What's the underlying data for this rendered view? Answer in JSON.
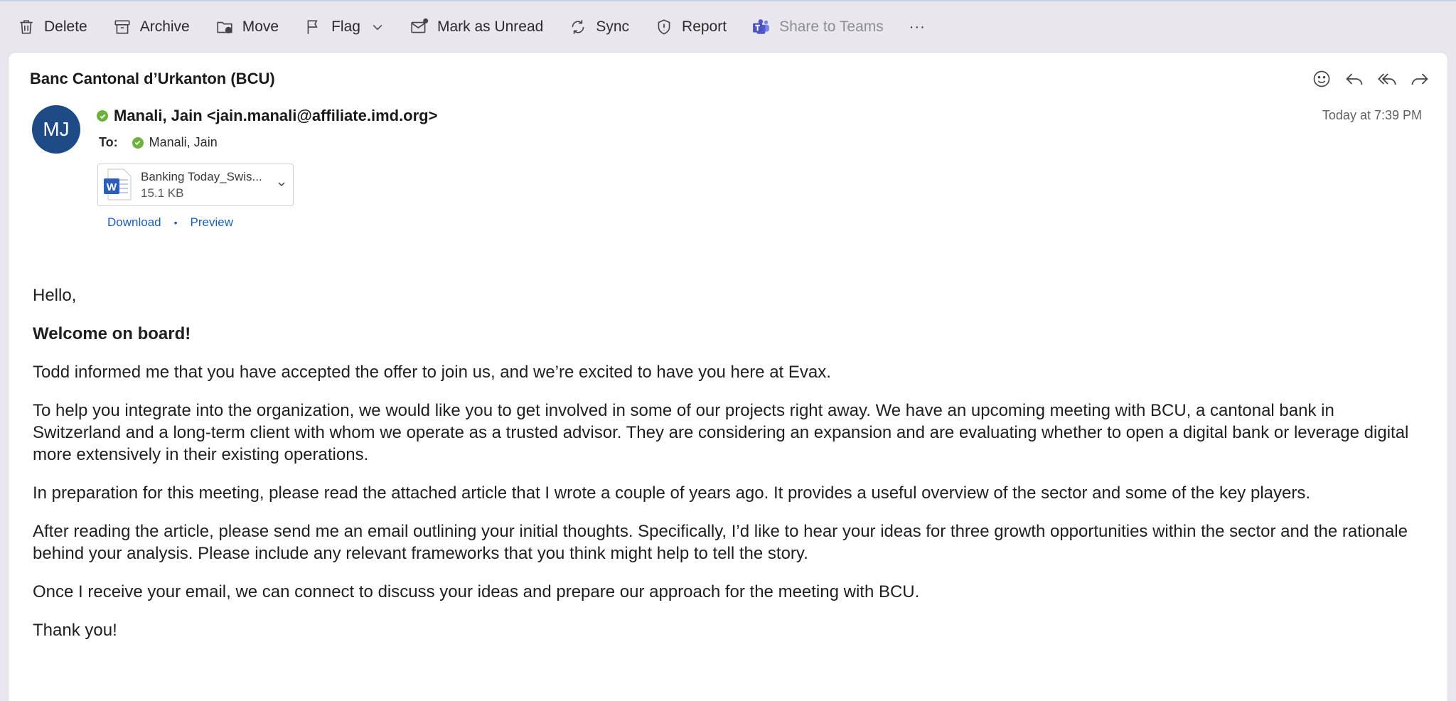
{
  "toolbar": {
    "delete": "Delete",
    "archive": "Archive",
    "move": "Move",
    "flag": "Flag",
    "mark_unread": "Mark as Unread",
    "sync": "Sync",
    "report": "Report",
    "share_teams": "Share to Teams",
    "more": "···"
  },
  "email": {
    "subject": "Banc Cantonal d’Urkanton (BCU)",
    "avatar_initials": "MJ",
    "avatar_color": "#1e4a86",
    "sender": "Manali, Jain <jain.manali@affiliate.imd.org>",
    "date": "Today at 7:39 PM",
    "to_label": "To:",
    "to_name": "Manali, Jain",
    "presence_color": "#6bb33a"
  },
  "attachment": {
    "name": "Banking Today_Swis...",
    "size": "15.1 KB",
    "icon": "word-doc-icon",
    "download": "Download",
    "preview": "Preview"
  },
  "body": {
    "greeting": "Hello,",
    "welcome": "Welcome on board!",
    "p1": "Todd informed me that you have accepted the offer to join us, and we’re excited to have you here at Evax.",
    "p2": "To help you integrate into the organization, we would like you to get involved in some of our projects right away. We have an upcoming meeting with BCU, a cantonal bank in Switzerland and a long-term client with whom we operate as a trusted advisor. They are considering an expansion and are evaluating whether to open a digital bank or leverage digital more extensively in their existing operations.",
    "p3": "In preparation for this meeting, please read the attached article that I wrote a couple of years ago. It provides a useful overview of the sector and some of the key players.",
    "p4": "After reading the article, please send me an email outlining your initial thoughts. Specifically, I’d like to hear your ideas for three growth opportunities within the sector and the rationale behind your analysis. Please include any relevant frameworks that you think might help to tell the story.",
    "p5": "Once I receive your email, we can connect to discuss your ideas and prepare our approach for the meeting with BCU.",
    "closing": "Thank you!"
  }
}
